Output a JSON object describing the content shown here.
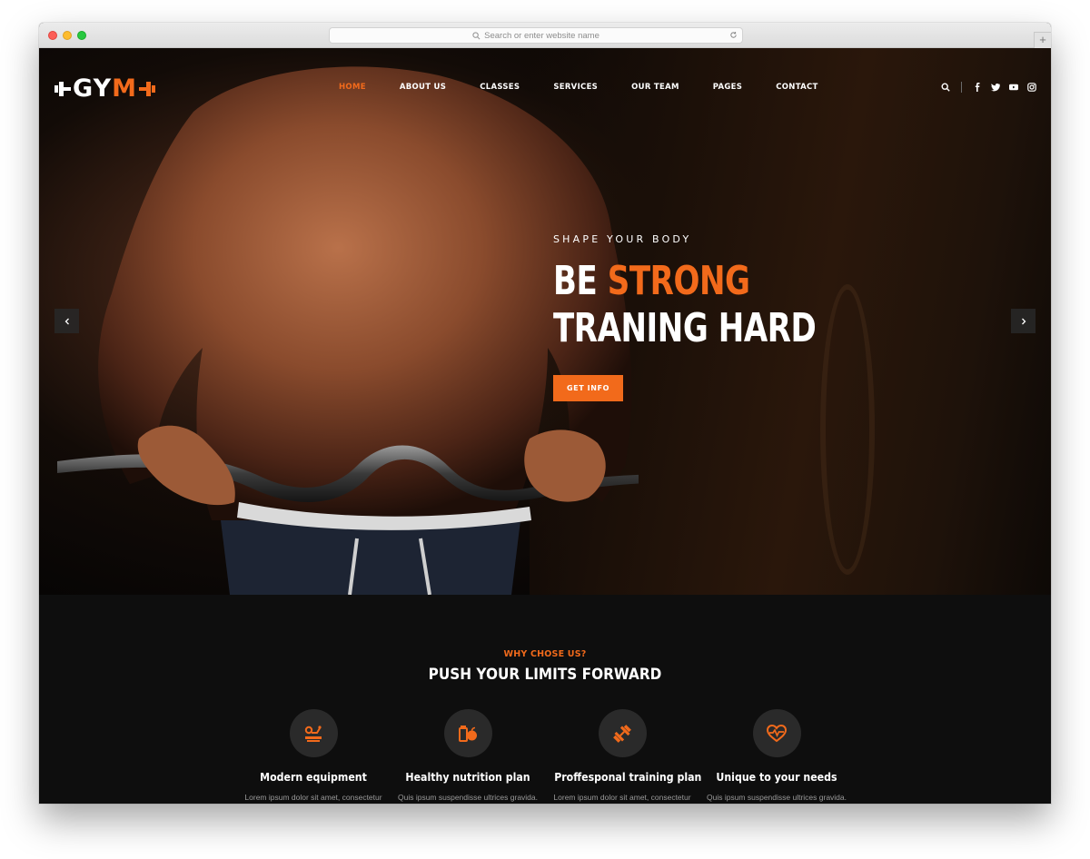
{
  "browser": {
    "address_placeholder": "Search or enter website name"
  },
  "logo": {
    "part1": "GY",
    "part2": "M"
  },
  "nav": {
    "items": [
      {
        "label": "HOME",
        "active": true
      },
      {
        "label": "ABOUT US",
        "active": false
      },
      {
        "label": "CLASSES",
        "active": false
      },
      {
        "label": "SERVICES",
        "active": false
      },
      {
        "label": "OUR TEAM",
        "active": false
      },
      {
        "label": "PAGES",
        "active": false
      },
      {
        "label": "CONTACT",
        "active": false
      }
    ],
    "icons": [
      "search-icon",
      "facebook-icon",
      "twitter-icon",
      "youtube-icon",
      "instagram-icon"
    ]
  },
  "hero": {
    "eyebrow": "SHAPE YOUR BODY",
    "headline_word1": "BE",
    "headline_word2": "STRONG",
    "headline_line2": "TRANING HARD",
    "cta_label": "GET INFO"
  },
  "features": {
    "eyebrow": "WHY CHOSE US?",
    "title": "PUSH YOUR LIMITS FORWARD",
    "items": [
      {
        "title": "Modern equipment",
        "text": "Lorem ipsum dolor sit amet, consectetur",
        "icon": "equipment-icon"
      },
      {
        "title": "Healthy nutrition plan",
        "text": "Quis ipsum suspendisse ultrices gravida.",
        "icon": "nutrition-icon"
      },
      {
        "title": "Proffesponal training plan",
        "text": "Lorem ipsum dolor sit amet, consectetur",
        "icon": "dumbbell-icon"
      },
      {
        "title": "Unique to your needs",
        "text": "Quis ipsum suspendisse ultrices gravida.",
        "icon": "heart-pulse-icon"
      }
    ]
  },
  "colors": {
    "accent": "#f26a1b",
    "background": "#0e0e0e",
    "text": "#ffffff"
  }
}
